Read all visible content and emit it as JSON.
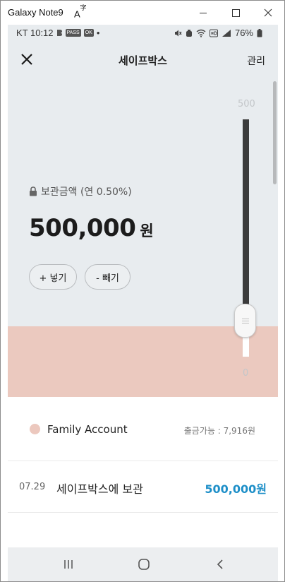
{
  "window": {
    "title": "Galaxy Note9",
    "font_icon": "A",
    "font_icon_sup": "字"
  },
  "status_bar": {
    "carrier_time": "KT 10:12",
    "badge_1": "PASS",
    "badge_2": "OK",
    "dot": "•",
    "battery": "76%"
  },
  "header": {
    "title": "세이프박스",
    "manage_label": "관리"
  },
  "safebox": {
    "label": "보관금액 (연 0.50%)",
    "amount": "500,000",
    "unit": "원",
    "deposit_label": "+ 넣기",
    "withdraw_label": "- 빼기",
    "slider_max_label": "500",
    "slider_min_label": "0",
    "slider_value_fraction": 1.0
  },
  "account": {
    "name": "Family Account",
    "available": "출금가능 : 7,916원"
  },
  "transactions": [
    {
      "date": "07.29",
      "description": "세이프박스에 보관",
      "amount": "500,000원"
    }
  ],
  "colors": {
    "gray_bg": "#e8ecef",
    "pink_bg": "#ebc9bf",
    "amount_blue": "#1e8fc8",
    "dot_pink": "#ecc8be"
  }
}
